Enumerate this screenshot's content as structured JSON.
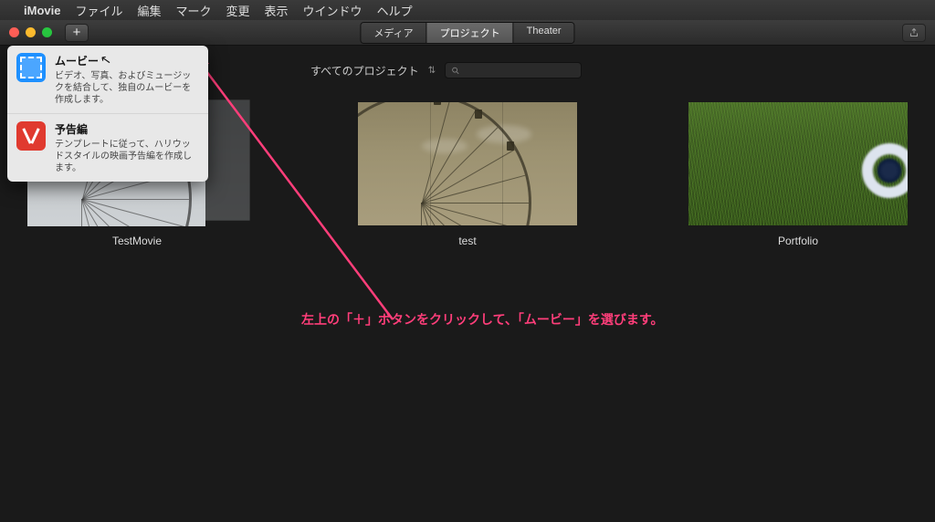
{
  "menubar": {
    "app": "iMovie",
    "items": [
      "ファイル",
      "編集",
      "マーク",
      "変更",
      "表示",
      "ウインドウ",
      "ヘルプ"
    ]
  },
  "toolbar": {
    "plus_label": "+",
    "segments": {
      "media": "メディア",
      "project": "プロジェクト",
      "theater": "Theater"
    }
  },
  "filter": {
    "label": "すべてのプロジェクト",
    "search_placeholder": ""
  },
  "projects": {
    "p1": "TestMovie",
    "p2": "test",
    "p3": "Portfolio"
  },
  "popover": {
    "movie": {
      "title": "ムービー",
      "desc": "ビデオ、写真、およびミュージックを結合して、独自のムービーを作成します。"
    },
    "trailer": {
      "title": "予告編",
      "desc": "テンプレートに従って、ハリウッドスタイルの映画予告編を作成します。"
    }
  },
  "annotation": "左上の「＋」ボタンをクリックして、「ムービー」を選びます。"
}
